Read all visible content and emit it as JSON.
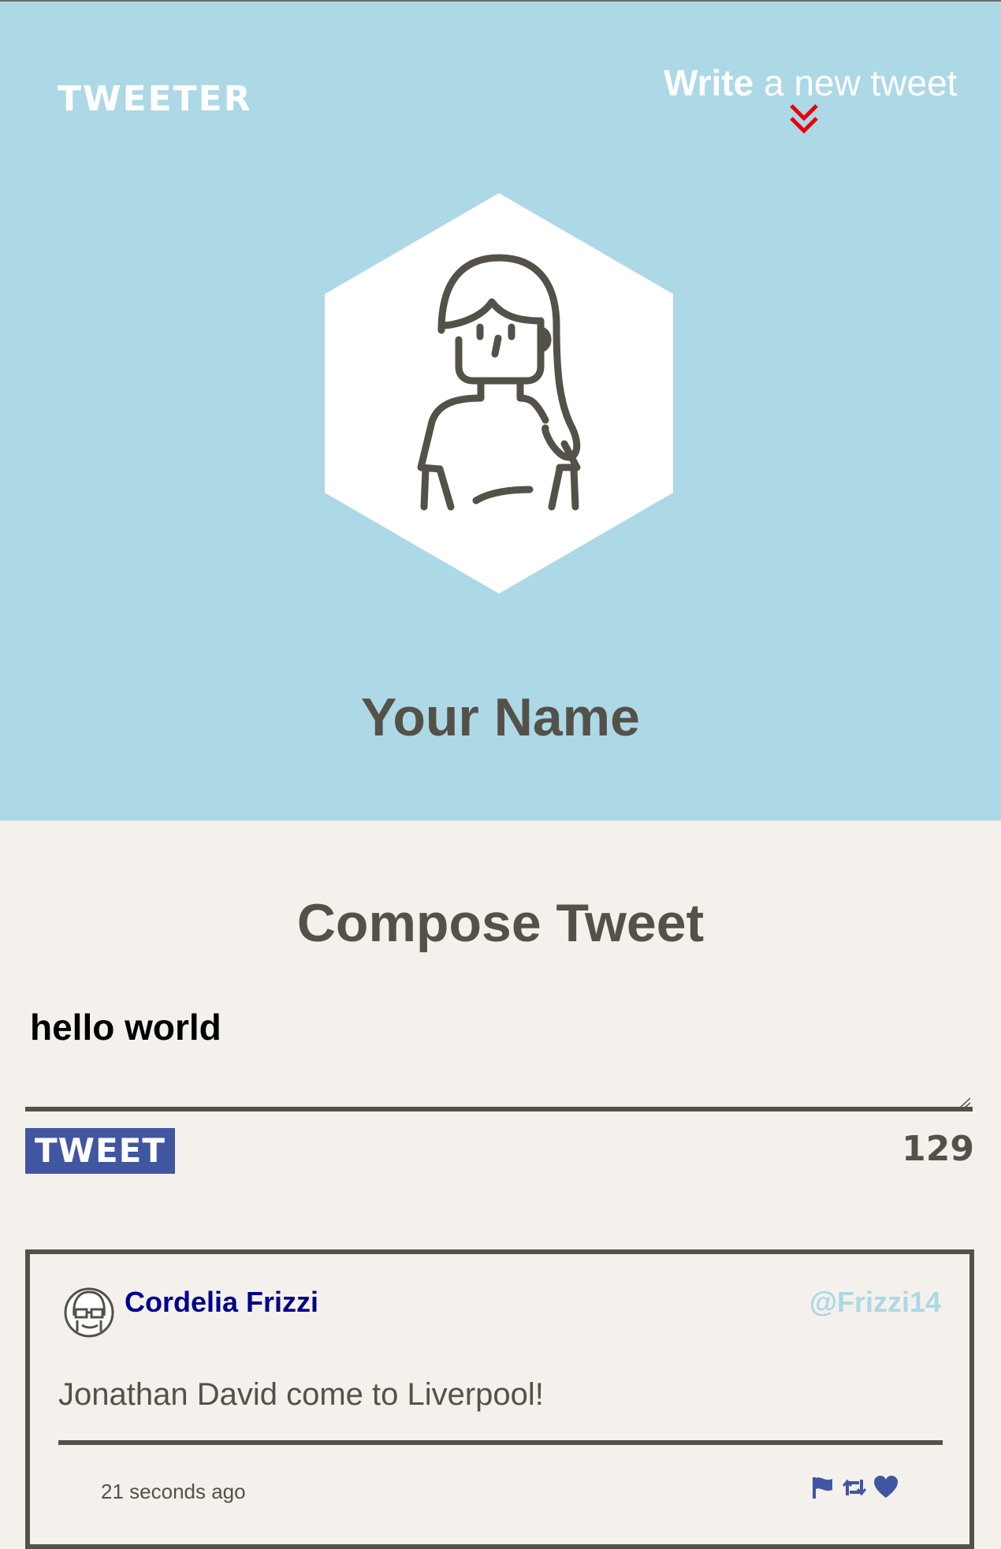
{
  "nav": {
    "brand": "TWEETER",
    "write_bold": "Write",
    "write_rest": " a new tweet"
  },
  "profile": {
    "name": "Your Name",
    "avatar_icon": "girl-avatar-icon"
  },
  "compose": {
    "title": "Compose Tweet",
    "input_value": "hello world",
    "tweet_button": "TWEET",
    "counter": "129"
  },
  "tweets": [
    {
      "author": "Cordelia Frizzi",
      "handle": "@Frizzi14",
      "text": "Jonathan David come to Liverpool!",
      "time": "21 seconds ago",
      "actions": [
        "flag-icon",
        "retweet-icon",
        "heart-icon"
      ]
    }
  ],
  "colors": {
    "header_bg": "#add8e6",
    "page_bg": "#f4f1ec",
    "text": "#545149",
    "button": "#4056a1",
    "author": "#00008b",
    "accent_red": "#e8000b"
  }
}
